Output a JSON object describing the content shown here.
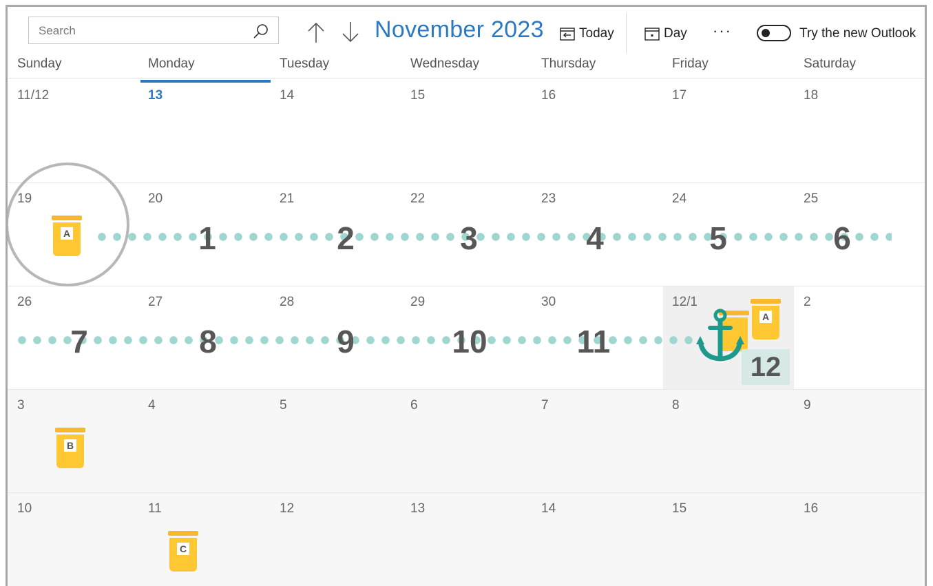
{
  "toolbar": {
    "search_placeholder": "Search",
    "month_title": "November 2023",
    "today_label": "Today",
    "day_label": "Day",
    "more_label": "···",
    "try_new_outlook_label": "Try the new Outlook",
    "toggle_on": false
  },
  "day_headers": [
    "Sunday",
    "Monday",
    "Tuesday",
    "Wednesday",
    "Thursday",
    "Friday",
    "Saturday"
  ],
  "weeks": [
    [
      "11/12",
      "13",
      "14",
      "15",
      "16",
      "17",
      "18"
    ],
    [
      "19",
      "20",
      "21",
      "22",
      "23",
      "24",
      "25"
    ],
    [
      "26",
      "27",
      "28",
      "29",
      "30",
      "12/1",
      "2"
    ],
    [
      "3",
      "4",
      "5",
      "6",
      "7",
      "8",
      "9"
    ],
    [
      "10",
      "11",
      "12",
      "13",
      "14",
      "15",
      "16"
    ]
  ],
  "today_date": "13",
  "annotations": {
    "week2_counts": [
      "1",
      "2",
      "3",
      "4",
      "5",
      "6"
    ],
    "week3_counts": [
      "7",
      "8",
      "9",
      "10",
      "11"
    ],
    "final_count": "12",
    "jars": [
      {
        "label": "A",
        "location": "Sunday 19"
      },
      {
        "label": "A",
        "location": "Friday 12/1"
      },
      {
        "label": "",
        "location": "Friday 12/1"
      },
      {
        "label": "B",
        "location": "Sunday 3"
      },
      {
        "label": "C",
        "location": "Monday 11"
      }
    ],
    "colors": {
      "accent_blue": "#2b79c2",
      "jar_yellow": "#ffc832",
      "dot_teal": "#9fd6d0",
      "anchor_teal": "#1d9a8c",
      "count_gray": "#575757"
    }
  }
}
